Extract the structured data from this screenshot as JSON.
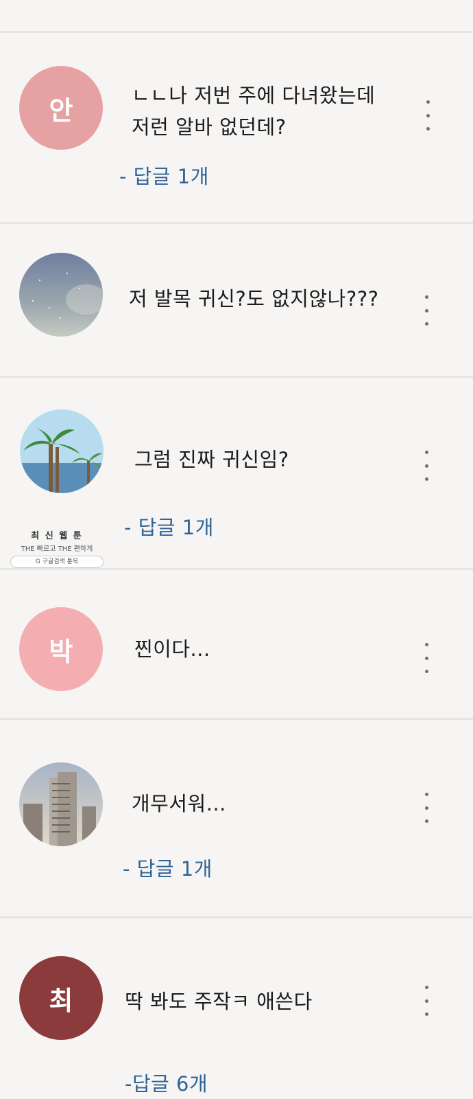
{
  "comments": [
    {
      "avatar_text": "안",
      "avatar_color": "#e6a2a3",
      "text": "ㄴㄴ나 저번 주에 다녀왔는데\n저런 알바 없던데?",
      "reply": "- 답글 1개"
    },
    {
      "avatar_text": "",
      "avatar_kind": "night-sky",
      "text": "저 발목 귀신?도 없지않나???",
      "reply": ""
    },
    {
      "avatar_text": "",
      "avatar_kind": "palm-beach",
      "text": "그럼 진짜 귀신임?",
      "reply": "- 답글 1개"
    },
    {
      "avatar_text": "박",
      "avatar_color": "#f4aeb1",
      "text": "찐이다...",
      "reply": ""
    },
    {
      "avatar_text": "",
      "avatar_kind": "buildings",
      "text": "개무서워...",
      "reply": "- 답글 1개"
    },
    {
      "avatar_text": "최",
      "avatar_color": "#8b3b3b",
      "text": "딱 봐도 주작ㅋ 애쓴다",
      "reply": "-답글 6개"
    }
  ],
  "ad": {
    "line1": "최 신 웹 툰",
    "line2": "THE 빠르고 THE 편하게",
    "search": "G 구글검색   툰북"
  },
  "colors": {
    "reply": "#2f6497",
    "background": "#f6f5f4",
    "divider": "#e6e5e3"
  }
}
